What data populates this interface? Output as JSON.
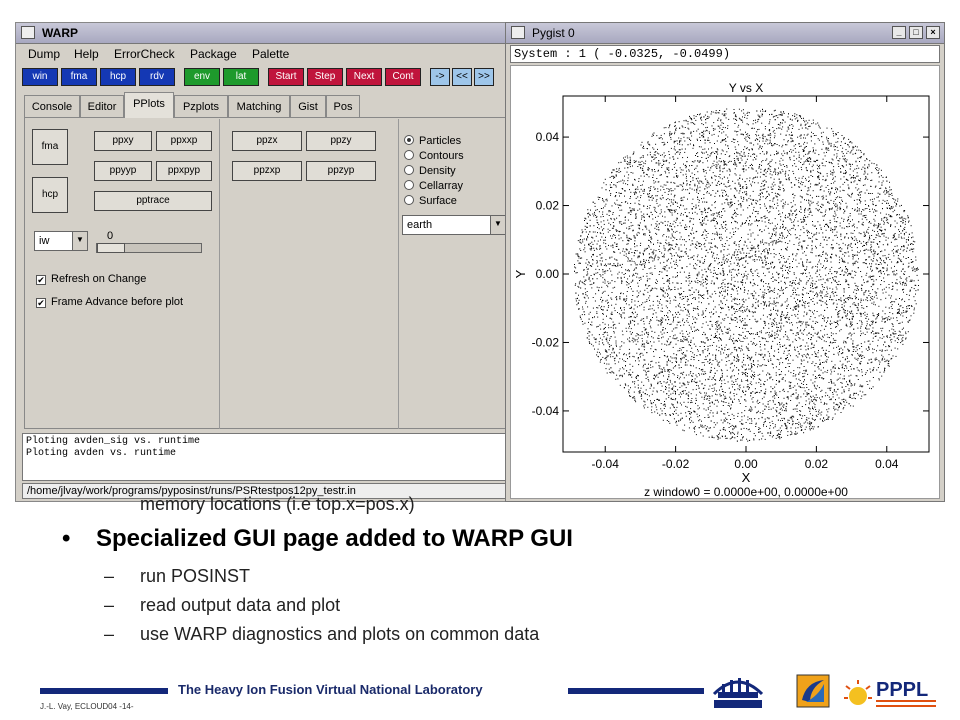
{
  "slide": {
    "overflow_text": "memory locations (i.e top.x=pos.x)",
    "bullet": "Specialized GUI page added to WARP GUI",
    "sub_items": [
      "run POSINST",
      "read output data and plot",
      "use WARP diagnostics and plots on common data"
    ],
    "footer_title": "The Heavy Ion Fusion Virtual National Laboratory",
    "footer_left": "J.-L. Vay,  ECLOUD04    -14-"
  },
  "warp": {
    "title": "WARP",
    "menu": [
      "Dump",
      "Help",
      "ErrorCheck",
      "Package",
      "Palette"
    ],
    "toolbar": [
      {
        "label": "win",
        "color": "blue"
      },
      {
        "label": "fma",
        "color": "blue"
      },
      {
        "label": "hcp",
        "color": "blue"
      },
      {
        "label": "rdv",
        "color": "blue"
      },
      {
        "label": "env",
        "color": "green"
      },
      {
        "label": "lat",
        "color": "green"
      },
      {
        "label": "Start",
        "color": "red"
      },
      {
        "label": "Step",
        "color": "red"
      },
      {
        "label": "Next",
        "color": "red"
      },
      {
        "label": "Cont",
        "color": "red"
      },
      {
        "label": "->",
        "color": "lblue"
      },
      {
        "label": "<<",
        "color": "lblue"
      },
      {
        "label": ">>",
        "color": "lblue"
      }
    ],
    "tabs": [
      "Console",
      "Editor",
      "PPlots",
      "Pzplots",
      "Matching",
      "Gist",
      "Pos"
    ],
    "active_tab": "PPlots",
    "side_buttons": [
      "fma",
      "hcp"
    ],
    "plot_buttons_a": [
      "ppxy",
      "ppxxp",
      "ppyyp",
      "ppxpyp",
      "pptrace"
    ],
    "plot_buttons_b": [
      "ppzx",
      "ppzy",
      "ppzxp",
      "ppzyp"
    ],
    "radio_options": [
      "Particles",
      "Contours",
      "Density",
      "Cellarray",
      "Surface"
    ],
    "radio_selected": "Particles",
    "palette_select": "earth",
    "window_select": "iw",
    "slider_value": "0",
    "checkboxes": [
      {
        "label": "Refresh on Change",
        "checked": true
      },
      {
        "label": "Frame Advance before plot",
        "checked": true
      }
    ],
    "console_lines": [
      "Ploting avden_sig vs. runtime",
      "Ploting avden vs. runtime"
    ],
    "path": "/home/jlvay/work/programs/pyposinst/runs/PSRtestpos12py_testr.in"
  },
  "pygist": {
    "title": "Pygist 0",
    "system_line": "System : 1 ( -0.0325,  -0.0499)",
    "status_line": "z window0 = 0.0000e+00, 0.0000e+00"
  },
  "chart_data": {
    "type": "scatter",
    "title": "Y vs X",
    "xlabel": "X",
    "ylabel": "Y",
    "xlim": [
      -0.052,
      0.052
    ],
    "ylim": [
      -0.052,
      0.052
    ],
    "xticks": [
      "-0.04",
      "-0.02",
      "0.00",
      "0.02",
      "0.04"
    ],
    "yticks": [
      "0.04",
      "0.02",
      "0.00",
      "-0.02",
      "-0.04"
    ],
    "distribution": "uniform disk",
    "center": [
      0.0,
      0.0
    ],
    "radius": 0.049,
    "grid": false,
    "marker_color": "#000000"
  }
}
